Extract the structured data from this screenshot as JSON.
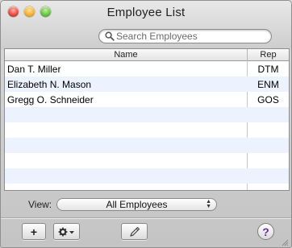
{
  "window": {
    "title": "Employee List"
  },
  "search": {
    "placeholder": "Search Employees"
  },
  "table": {
    "columns": {
      "name": "Name",
      "rep": "Rep"
    },
    "rows": [
      {
        "name": "Dan T. Miller",
        "rep": "DTM"
      },
      {
        "name": "Elizabeth N. Mason",
        "rep": "ENM"
      },
      {
        "name": "Gregg O. Schneider",
        "rep": "GOS"
      }
    ]
  },
  "view": {
    "label": "View:",
    "selected": "All Employees"
  },
  "toolbar": {
    "add": "+",
    "help": "?"
  },
  "colors": {
    "alt_row": "#edf3fe",
    "help_accent": "#6c2ea8"
  },
  "icons": {
    "search": "magnifier-icon",
    "gear": "gear-icon",
    "edit": "pencil-icon"
  }
}
